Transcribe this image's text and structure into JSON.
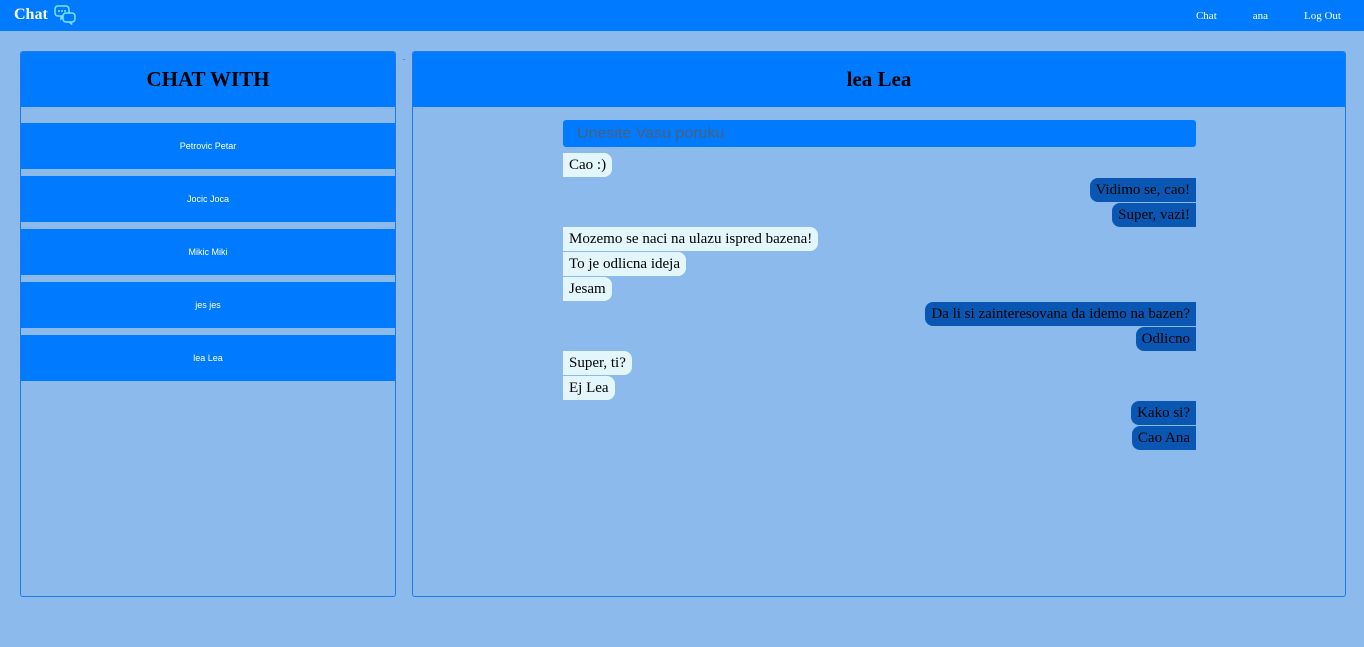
{
  "navbar": {
    "brand": "Chat",
    "brand_icon": "chat-bubbles-icon",
    "links": [
      "Chat",
      "ana",
      "Log Out"
    ]
  },
  "sidebar": {
    "title": "CHAT WITH",
    "contacts": [
      "Petrovic Petar",
      "Jocic Joca",
      "Mikic Miki",
      "jes jes",
      "lea Lea"
    ]
  },
  "chat": {
    "title": "lea Lea",
    "input_placeholder": "Unesite Vasu poruku",
    "input_value": "",
    "messages": [
      {
        "side": "in",
        "text": "Cao :)"
      },
      {
        "side": "out",
        "text": "Vidimo se, cao!"
      },
      {
        "side": "out",
        "text": "Super, vazi!"
      },
      {
        "side": "in",
        "text": "Mozemo se naci na ulazu ispred bazena!"
      },
      {
        "side": "in",
        "text": "To je odlicna ideja"
      },
      {
        "side": "in",
        "text": "Jesam"
      },
      {
        "side": "out",
        "text": "Da li si zainteresovana da idemo na bazen?"
      },
      {
        "side": "out",
        "text": "Odlicno"
      },
      {
        "side": "in",
        "text": "Super, ti?"
      },
      {
        "side": "in",
        "text": "Ej Lea"
      },
      {
        "side": "out",
        "text": "Kako si?"
      },
      {
        "side": "out",
        "text": "Cao Ana"
      }
    ]
  },
  "colors": {
    "primary": "#007bff",
    "background": "#8cbaec",
    "incoming_bubble": "#e3f6fc",
    "outgoing_bubble": "#0a57b3"
  }
}
